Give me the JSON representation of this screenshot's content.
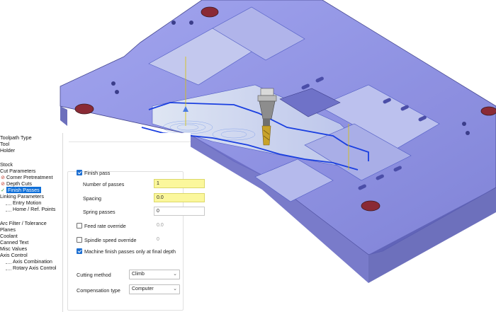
{
  "tree": {
    "items": [
      {
        "label": "Toolpath Type",
        "icon": "",
        "selected": false,
        "indent": 0
      },
      {
        "label": "Tool",
        "icon": "",
        "selected": false,
        "indent": 0
      },
      {
        "label": "Holder",
        "icon": "",
        "selected": false,
        "indent": 0
      },
      {
        "label": "Stock",
        "icon": "",
        "selected": false,
        "indent": 0
      },
      {
        "label": "Cut Parameters",
        "icon": "",
        "selected": false,
        "indent": 0
      },
      {
        "label": "Corner Pretreatment",
        "icon": "disabled-icon",
        "selected": false,
        "indent": 1
      },
      {
        "label": "Depth Cuts",
        "icon": "disabled-icon",
        "selected": false,
        "indent": 1
      },
      {
        "label": "Finish Passes",
        "icon": "check-icon",
        "selected": true,
        "indent": 1
      },
      {
        "label": "Linking Parameters",
        "icon": "",
        "selected": false,
        "indent": 0
      },
      {
        "label": "Entry Motion",
        "icon": "",
        "selected": false,
        "indent": 2
      },
      {
        "label": "Home / Ref. Points",
        "icon": "",
        "selected": false,
        "indent": 2
      },
      {
        "label": "Arc Filter / Tolerance",
        "icon": "",
        "selected": false,
        "indent": 0
      },
      {
        "label": "Planes",
        "icon": "",
        "selected": false,
        "indent": 0
      },
      {
        "label": "Coolant",
        "icon": "",
        "selected": false,
        "indent": 0
      },
      {
        "label": "Canned Text",
        "icon": "",
        "selected": false,
        "indent": 0
      },
      {
        "label": "Misc Values",
        "icon": "",
        "selected": false,
        "indent": 0
      },
      {
        "label": "Axis Control",
        "icon": "",
        "selected": false,
        "indent": 0
      },
      {
        "label": "Axis Combination",
        "icon": "",
        "selected": false,
        "indent": 2
      },
      {
        "label": "Rotary Axis Control",
        "icon": "",
        "selected": false,
        "indent": 2
      }
    ]
  },
  "finish": {
    "finish_pass_label": "Finish pass",
    "finish_pass_checked": true,
    "num_passes_label": "Number of passes",
    "num_passes_value": "1",
    "spacing_label": "Spacing",
    "spacing_value": "0.0",
    "spring_label": "Spring passes",
    "spring_value": "0",
    "feed_override_label": "Feed rate override",
    "feed_override_checked": false,
    "feed_override_value": "0.0",
    "spindle_override_label": "Spindle speed override",
    "spindle_override_checked": false,
    "spindle_override_value": "0",
    "final_depth_label": "Machine finish passes only at final depth",
    "final_depth_checked": true,
    "cutting_method_label": "Cutting method",
    "cutting_method_value": "Climb",
    "compensation_label": "Compensation type",
    "compensation_value": "Computer"
  },
  "colors": {
    "part_fill": "#7c7fd8",
    "part_top": "#8e92e6",
    "part_side": "#5a5cb0",
    "toolpath": "#1a3fe0",
    "holes": "#8a2a35",
    "tool_gold": "#c8a22a",
    "highlight_field": "#fbf79c",
    "selection": "#0f6fd8"
  }
}
